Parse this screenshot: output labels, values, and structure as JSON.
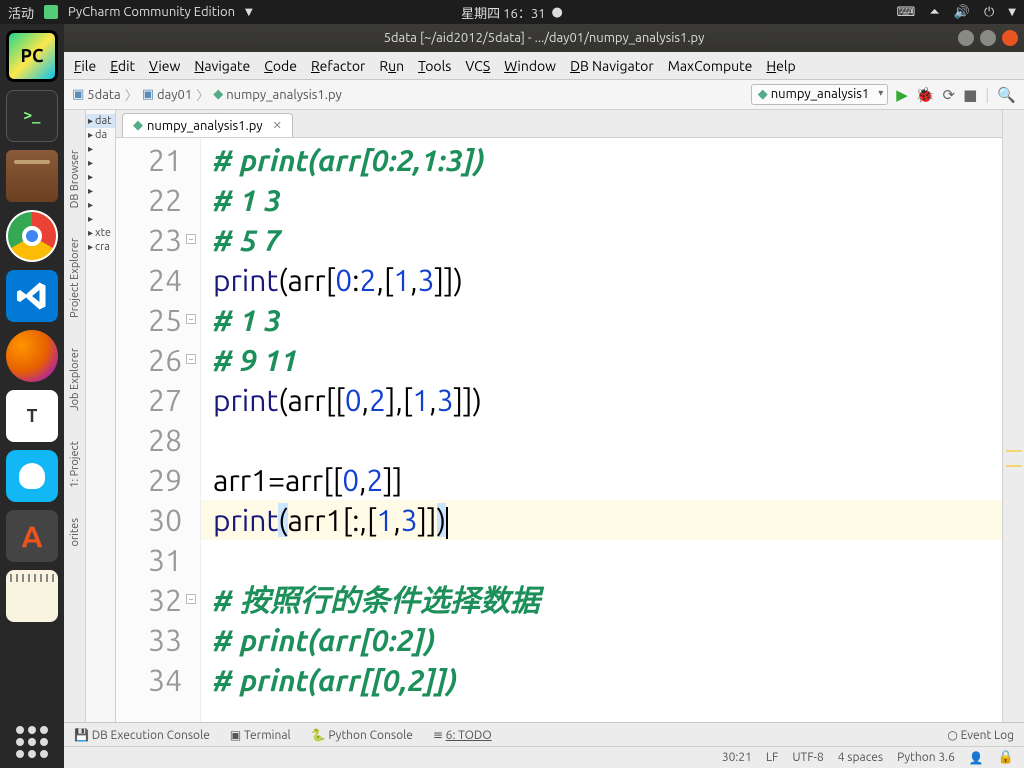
{
  "topbar": {
    "activity": "活动",
    "app": "PyCharm Community Edition",
    "clock": "星期四 16：31",
    "icons": [
      "net",
      "vol",
      "power"
    ]
  },
  "dock": [
    "PyCharm",
    "Terminal",
    "Files",
    "Chrome",
    "VSCode",
    "Firefox",
    "Text",
    "QQ",
    "Software",
    "Notes"
  ],
  "title": "5data [~/aid2012/5data] - .../day01/numpy_analysis1.py",
  "menu": [
    "File",
    "Edit",
    "View",
    "Navigate",
    "Code",
    "Refactor",
    "Run",
    "Tools",
    "VCS",
    "Window",
    "DB Navigator",
    "MaxCompute",
    "Help"
  ],
  "crumbs": [
    "5data",
    "day01",
    "numpy_analysis1.py"
  ],
  "run_config": "numpy_analysis1",
  "left_tools": [
    "DB Browser",
    "Project Explorer",
    "Job Explorer",
    "1: Project",
    "orites"
  ],
  "tree": [
    "dat",
    "da",
    "",
    "",
    "",
    "",
    "",
    "",
    "xte",
    "cra"
  ],
  "tab": "numpy_analysis1.py",
  "code_lines": [
    {
      "n": 21,
      "t": "comment",
      "s": "# print(arr[0:2,1:3])"
    },
    {
      "n": 22,
      "t": "comment",
      "s": "# 1 3"
    },
    {
      "n": 23,
      "t": "comment",
      "s": "# 5 7",
      "fold": true
    },
    {
      "n": 24,
      "t": "code",
      "tokens": [
        [
          "fn",
          "print"
        ],
        [
          "punc",
          "("
        ],
        [
          "ident",
          "arr"
        ],
        [
          "punc",
          "["
        ],
        [
          "num",
          "0"
        ],
        [
          "op",
          ":"
        ],
        [
          "num",
          "2"
        ],
        [
          "punc",
          ","
        ],
        [
          "punc",
          "["
        ],
        [
          "num",
          "1"
        ],
        [
          "punc",
          ","
        ],
        [
          "num",
          "3"
        ],
        [
          "punc",
          "]"
        ],
        [
          "punc",
          "]"
        ],
        [
          "punc",
          ")"
        ]
      ]
    },
    {
      "n": 25,
      "t": "comment",
      "s": "# 1 3",
      "fold": true
    },
    {
      "n": 26,
      "t": "comment",
      "s": "# 9 11",
      "fold": true
    },
    {
      "n": 27,
      "t": "code",
      "tokens": [
        [
          "fn",
          "print"
        ],
        [
          "punc",
          "("
        ],
        [
          "ident",
          "arr"
        ],
        [
          "punc",
          "["
        ],
        [
          "punc",
          "["
        ],
        [
          "num",
          "0"
        ],
        [
          "punc",
          ","
        ],
        [
          "num",
          "2"
        ],
        [
          "punc",
          "]"
        ],
        [
          "punc",
          ","
        ],
        [
          "punc",
          "["
        ],
        [
          "num",
          "1"
        ],
        [
          "punc",
          ","
        ],
        [
          "num",
          "3"
        ],
        [
          "punc",
          "]"
        ],
        [
          "punc",
          "]"
        ],
        [
          "punc",
          ")"
        ]
      ]
    },
    {
      "n": 28,
      "t": "blank"
    },
    {
      "n": 29,
      "t": "code",
      "tokens": [
        [
          "ident",
          "arr1"
        ],
        [
          "op",
          "="
        ],
        [
          "ident",
          "arr"
        ],
        [
          "punc",
          "["
        ],
        [
          "punc",
          "["
        ],
        [
          "num",
          "0"
        ],
        [
          "punc",
          ","
        ],
        [
          "num",
          "2"
        ],
        [
          "punc",
          "]"
        ],
        [
          "punc",
          "]"
        ]
      ]
    },
    {
      "n": 30,
      "t": "code",
      "hl": true,
      "cursor": true,
      "tokens": [
        [
          "fn",
          "print"
        ],
        [
          "brkt",
          "("
        ],
        [
          "ident",
          "arr1"
        ],
        [
          "punc",
          "["
        ],
        [
          "op",
          ":"
        ],
        [
          "punc",
          ","
        ],
        [
          "punc",
          "["
        ],
        [
          "num",
          "1"
        ],
        [
          "punc",
          ","
        ],
        [
          "num",
          "3"
        ],
        [
          "punc",
          "]"
        ],
        [
          "punc",
          "]"
        ],
        [
          "brkt",
          ")"
        ]
      ]
    },
    {
      "n": 31,
      "t": "blank"
    },
    {
      "n": 32,
      "t": "comment",
      "s": "# 按照行的条件选择数据",
      "fold": true
    },
    {
      "n": 33,
      "t": "comment",
      "s": "# print(arr[0:2])"
    },
    {
      "n": 34,
      "t": "comment",
      "s": "# print(arr[[0,2]])"
    }
  ],
  "bottom": {
    "db": "DB Execution Console",
    "term": "Terminal",
    "py": "Python Console",
    "todo": "6: TODO",
    "event": "Event Log"
  },
  "status": {
    "pos": "30:21",
    "lf": "LF",
    "enc": "UTF-8",
    "indent": "4 spaces",
    "py": "Python 3.6"
  }
}
